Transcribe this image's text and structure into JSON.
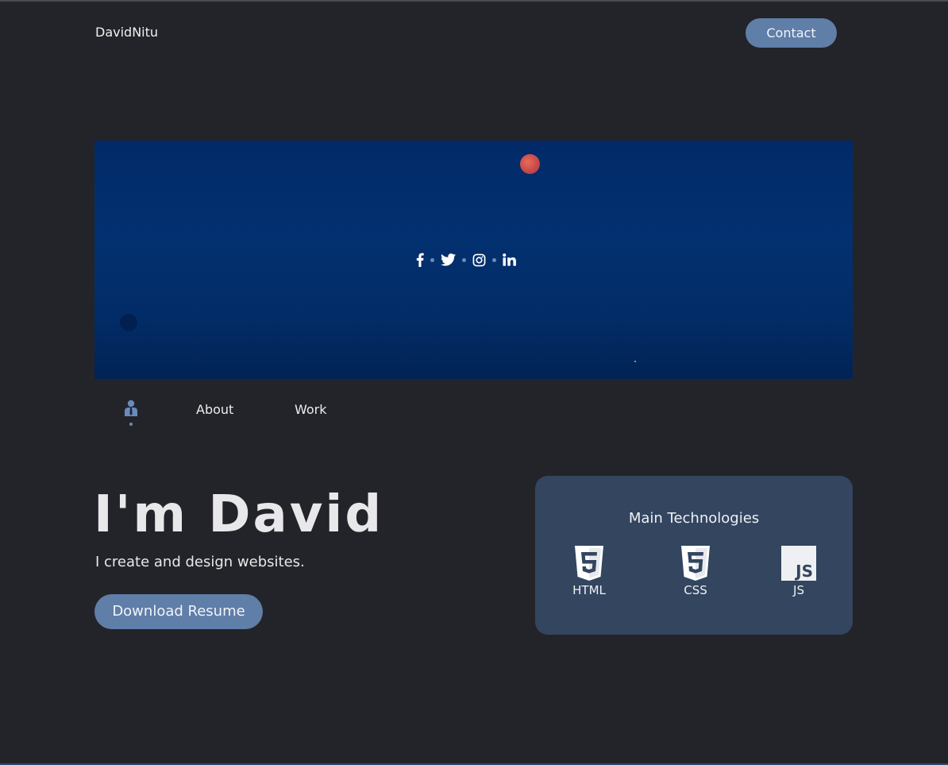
{
  "header": {
    "brand": "DavidNitu",
    "contact_label": "Contact"
  },
  "hero": {
    "social_icons": [
      "facebook-icon",
      "twitter-icon",
      "instagram-icon",
      "linkedin-icon"
    ]
  },
  "tabs": {
    "profile_icon": "person-icon",
    "about_label": "About",
    "work_label": "Work"
  },
  "intro": {
    "headline": "I'm David",
    "subline": "I create and design websites.",
    "resume_label": "Download Resume"
  },
  "technologies": {
    "title": "Main Technologies",
    "items": [
      {
        "icon": "html5-icon",
        "label": "HTML"
      },
      {
        "icon": "css3-icon",
        "label": "CSS"
      },
      {
        "icon": "js-icon",
        "label": "JS"
      }
    ]
  },
  "colors": {
    "background": "#232429",
    "accent": "#5f7ea8",
    "card": "#33455f",
    "hero": "#033070"
  }
}
